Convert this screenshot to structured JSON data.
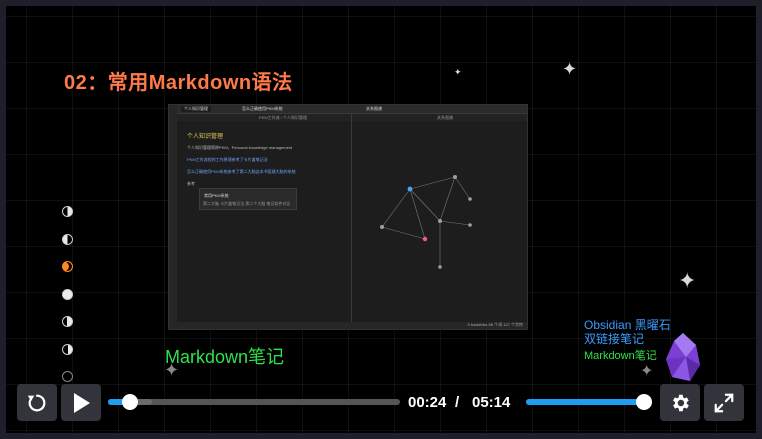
{
  "slide": {
    "title": "02：常用Markdown语法",
    "brand_label": "Markdown笔记",
    "obsidian_line1": "Obsidian 黑曜石",
    "obsidian_line2": "双链接笔记",
    "obsidian_line3": "Markdown笔记"
  },
  "app": {
    "tab1": "个人知识管理",
    "tab2": "怎么正确使用PKM系统",
    "tab3": "关系图谱",
    "path": "PKM工作流 / 个人知识管理",
    "graph_header": "关系图谱",
    "note_heading": "个人知识管理",
    "note_line1": "个人知识管理简称PKM，Personal knowledge management",
    "note_line2": "PKM工作流程的工作原理参考了卡片盒笔记法",
    "note_line3": "怎么正确使用PKM系统参考了第二大脑这本书搭建大脑的系统",
    "note_line4": "参考",
    "popup_title": "常用PKM系统",
    "popup_line": "第二大脑   卡片盒笔记法   第二个大脑   笔记软件对比",
    "status": "0 backlinks   58 个词   127 个字符"
  },
  "player": {
    "current_time": "00:24",
    "separator": "/",
    "duration": "05:14",
    "progress": 0.077,
    "buffered": 0.15,
    "volume": 1.0
  },
  "icons": {
    "replay": "replay-icon",
    "play": "play-icon",
    "settings": "gear-icon",
    "fullscreen": "fullscreen-icon"
  },
  "colors": {
    "title": "#ff7a4a",
    "progress": "#1e9cf0",
    "brand_green": "#2fe14a",
    "obsidian_blue": "#3a9bff"
  }
}
